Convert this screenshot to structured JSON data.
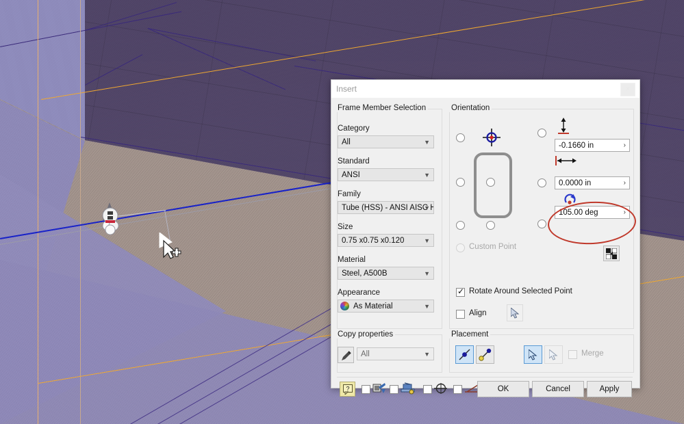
{
  "dialog": {
    "title": "Insert",
    "close_label": "×"
  },
  "frame_member": {
    "group_label": "Frame Member Selection",
    "fields": [
      {
        "label": "Category",
        "value": "All",
        "name": "category"
      },
      {
        "label": "Standard",
        "value": "ANSI",
        "name": "standard"
      },
      {
        "label": "Family",
        "value": "Tube (HSS) - ANSI AISC H",
        "name": "family"
      },
      {
        "label": "Size",
        "value": "0.75 x0.75 x0.120",
        "name": "size"
      },
      {
        "label": "Material",
        "value": "Steel, A500B",
        "name": "material"
      },
      {
        "label": "Appearance",
        "value": "As Material",
        "name": "appearance"
      }
    ]
  },
  "orientation": {
    "group_label": "Orientation",
    "offset_y": {
      "value": "-0.1660 in",
      "chevron": "›"
    },
    "offset_x": {
      "value": "0.0000 in",
      "chevron": "›"
    },
    "rotation": {
      "value": "105.00 deg",
      "chevron": "›"
    },
    "custom_point_label": "Custom Point",
    "rotate_around_label": "Rotate Around Selected Point",
    "align_label": "Align"
  },
  "copy_properties": {
    "group_label": "Copy properties",
    "value": "All"
  },
  "placement": {
    "group_label": "Placement",
    "merge_label": "Merge"
  },
  "buttons": {
    "ok": "OK",
    "cancel": "Cancel",
    "apply": "Apply"
  },
  "colors": {
    "accent_selected": "#cfe4f7",
    "accent_border": "#5a9ad4",
    "annotation_red": "#c0392b",
    "dialog_bg": "#f0f0f0",
    "wall": "#5e5272",
    "floor": "#a2938b",
    "sketch_blue": "#1822c8",
    "sketch_orange": "#f0a830",
    "sketch_purple": "#3a2a7a"
  }
}
